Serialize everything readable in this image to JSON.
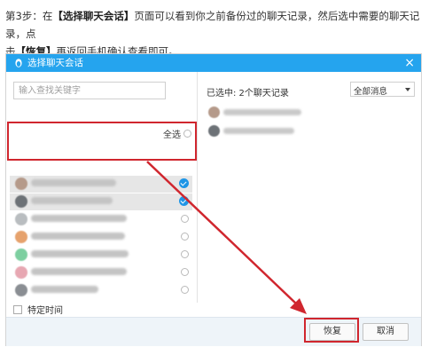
{
  "instruction": {
    "part1": "第3步：在",
    "bold1": "【选择聊天会话】",
    "part2": "页面可以看到你之前备份过的聊天记录，然后选中需要的聊天记录，点",
    "part3": "击",
    "bold2": "【恢复】",
    "part4": "再返回手机确认查看即可。"
  },
  "dialog": {
    "title": "选择聊天会话",
    "close_label": "×",
    "search_placeholder": "输入查找关键字",
    "select_all_label": "全选",
    "selected_count_label": "已选中: 2个聊天记录",
    "message_filter_value": "全部消息",
    "specific_time_label": "特定时间",
    "restore_button_label": "恢复",
    "cancel_button_label": "取消"
  },
  "contacts": [
    {
      "avatar_color": "#b59a8a",
      "checked": true
    },
    {
      "avatar_color": "#6d7277",
      "checked": true
    },
    {
      "avatar_color": "#b9bdc0",
      "checked": false
    },
    {
      "avatar_color": "#e6a26d",
      "checked": false
    },
    {
      "avatar_color": "#7dcfa0",
      "checked": false
    },
    {
      "avatar_color": "#e7a7b2",
      "checked": false
    },
    {
      "avatar_color": "#8a8e93",
      "checked": false
    }
  ],
  "selected_contacts": [
    {
      "avatar_color": "#b59a8a"
    },
    {
      "avatar_color": "#6d7277"
    }
  ],
  "colors": {
    "titlebar": "#25a4ee",
    "highlight": "#d0262e",
    "check": "#1e95e6"
  }
}
